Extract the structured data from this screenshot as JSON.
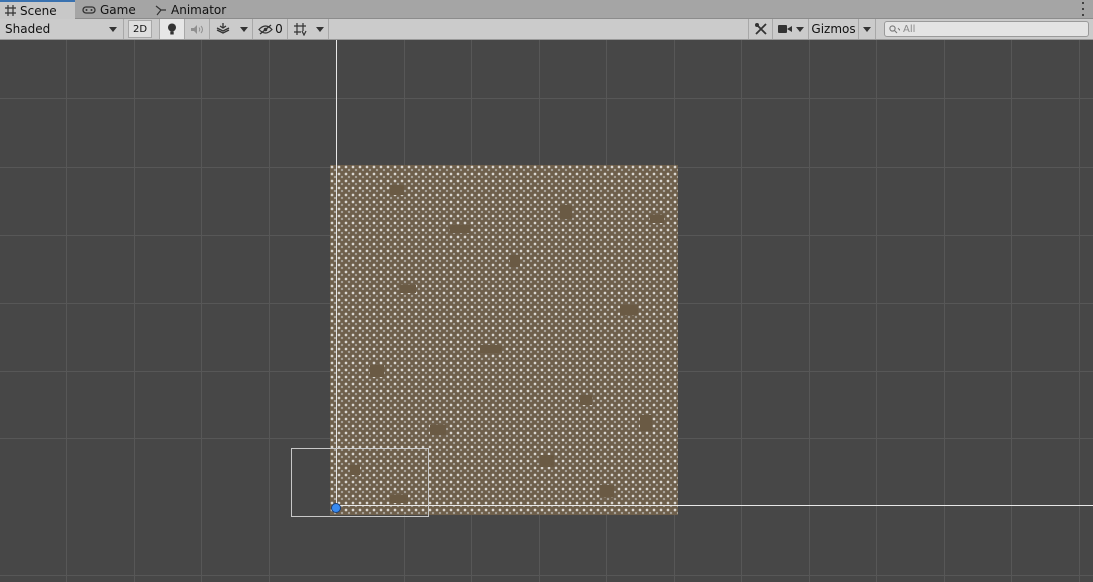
{
  "tabs": [
    {
      "label": "Scene",
      "icon": "grid-hash-icon",
      "active": true
    },
    {
      "label": "Game",
      "icon": "gamepad-icon",
      "active": false
    },
    {
      "label": "Animator",
      "icon": "animator-branch-icon",
      "active": false
    }
  ],
  "toolbar": {
    "draw_mode": "Shaded",
    "toggle_2d": "2D",
    "hidden_count": "0",
    "gizmos": "Gizmos"
  },
  "search": {
    "placeholder": "All"
  },
  "colors": {
    "tab_accent": "#3a72b0",
    "pivot": "#3a8bf0",
    "tile_dirt": "#6e5f4b",
    "tile_stone": "#d9d6d1"
  }
}
